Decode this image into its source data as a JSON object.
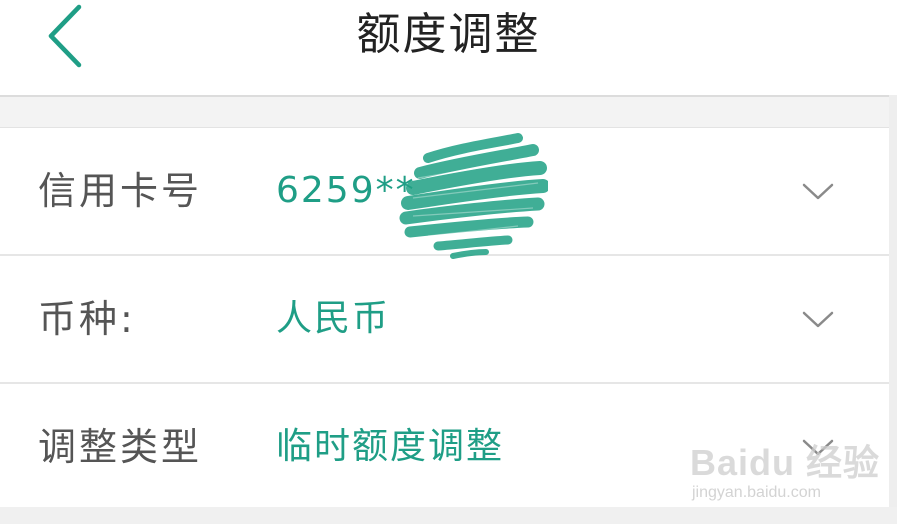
{
  "header": {
    "title": "额度调整",
    "back_icon": "chevron-left-icon"
  },
  "colors": {
    "accent": "#1f9e86",
    "label_text": "#555555",
    "title_text": "#222222",
    "divider": "#e6e6e6"
  },
  "form": {
    "rows": [
      {
        "label": "信用卡号",
        "value": "6259**",
        "icon": "chevron-down-icon"
      },
      {
        "label": "币种:",
        "value": "人民币",
        "icon": "chevron-down-icon"
      },
      {
        "label": "调整类型",
        "value": "临时额度调整",
        "icon": "chevron-down-icon"
      }
    ]
  },
  "watermark": {
    "brand": "Baidu 经验",
    "url": "jingyan.baidu.com"
  }
}
